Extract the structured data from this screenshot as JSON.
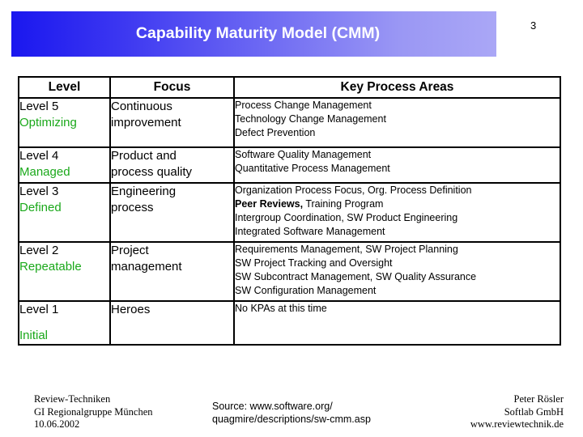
{
  "slide": {
    "number": "3",
    "title": "Capability Maturity Model (CMM)",
    "banner_gradient_from": "#1a17ef",
    "banner_gradient_to": "#aaa7f6",
    "header_bg": "#66ee66",
    "level_name_color": "#1aa81a"
  },
  "table": {
    "headers": {
      "level": "Level",
      "focus": "Focus",
      "kpa": "Key Process Areas"
    },
    "rows": [
      {
        "level_number": "Level 5",
        "level_name": "Optimizing",
        "focus_lines": [
          "Continuous",
          "improvement"
        ],
        "kpa_lines": [
          [
            {
              "text": "Process Change Management",
              "bold": false
            }
          ],
          [
            {
              "text": "Technology Change Management",
              "bold": false
            }
          ],
          [
            {
              "text": "Defect Prevention",
              "bold": false
            }
          ]
        ]
      },
      {
        "level_number": "Level 4",
        "level_name": "Managed",
        "focus_lines": [
          "Product and",
          "process quality"
        ],
        "kpa_lines": [
          [
            {
              "text": "Software Quality Management",
              "bold": false
            }
          ],
          [
            {
              "text": "Quantitative Process Management",
              "bold": false
            }
          ]
        ]
      },
      {
        "level_number": "Level 3",
        "level_name": "Defined",
        "focus_lines": [
          "Engineering",
          "process"
        ],
        "kpa_lines": [
          [
            {
              "text": "Organization Process Focus, Org. Process Definition",
              "bold": false
            }
          ],
          [
            {
              "text": "Peer Reviews,",
              "bold": true
            },
            {
              "text": " Training Program",
              "bold": false
            }
          ],
          [
            {
              "text": "Intergroup Coordination, SW Product Engineering",
              "bold": false
            }
          ],
          [
            {
              "text": "Integrated Software Management",
              "bold": false
            }
          ]
        ]
      },
      {
        "level_number": "Level 2",
        "level_name": "Repeatable",
        "focus_lines": [
          "Project",
          "management"
        ],
        "kpa_lines": [
          [
            {
              "text": "Requirements Management, SW Project Planning",
              "bold": false
            }
          ],
          [
            {
              "text": "SW Project Tracking and Oversight",
              "bold": false
            }
          ],
          [
            {
              "text": "SW Subcontract Management, SW Quality Assurance",
              "bold": false
            }
          ],
          [
            {
              "text": "SW Configuration Management",
              "bold": false
            }
          ]
        ]
      },
      {
        "level_number": "Level 1",
        "level_name": "Initial",
        "focus_lines": [
          "Heroes"
        ],
        "kpa_lines": [
          [
            {
              "text": "No KPAs at this time",
              "bold": false
            }
          ]
        ]
      }
    ]
  },
  "footer": {
    "left": [
      "Review-Techniken",
      "GI Regionalgruppe München",
      "10.06.2002"
    ],
    "center": [
      "Source:  www.software.org/",
      "quagmire/descriptions/sw-cmm.asp"
    ],
    "right": [
      "Peter Rösler",
      "Softlab GmbH",
      "www.reviewtechnik.de"
    ]
  }
}
